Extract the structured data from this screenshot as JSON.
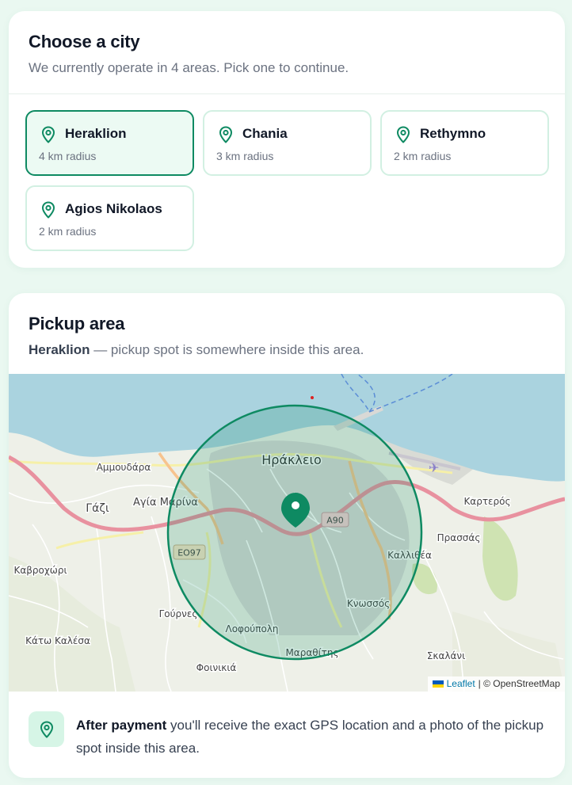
{
  "city_card": {
    "title": "Choose a city",
    "subtitle": "We currently operate in 4 areas. Pick one to continue."
  },
  "cities": [
    {
      "name": "Heraklion",
      "radius": "4 km radius",
      "selected": true
    },
    {
      "name": "Chania",
      "radius": "3 km radius",
      "selected": false
    },
    {
      "name": "Rethymno",
      "radius": "2 km radius",
      "selected": false
    },
    {
      "name": "Agios Nikolaos",
      "radius": "2 km radius",
      "selected": false
    }
  ],
  "pickup_card": {
    "title": "Pickup area",
    "city": "Heraklion",
    "subtitle_rest": " — pickup spot is somewhere inside this area."
  },
  "map": {
    "labels": {
      "heraklion": "Ηράκλειο",
      "ammoudara": "Αμμουδάρα",
      "gazi": "Γάζι",
      "agia_marina": "Αγία Μαρίνα",
      "kavrochori": "Καβροχώρι",
      "gournes": "Γούρνες",
      "kato_kalesa": "Κάτω Καλέσα",
      "lofoupoli": "Λοφούπολη",
      "foinikia": "Φοινικιά",
      "marathitis": "Μαραθίτης",
      "knossos": "Κνωσσός",
      "kallithea": "Καλλιθέα",
      "prassas": "Πρασσάς",
      "karteros": "Καρτερός",
      "skalani": "Σκαλάνι",
      "road_a90": "A90",
      "road_eo97": "ΕΟ97"
    },
    "attribution": {
      "leaflet": "Leaflet",
      "separator": " | © OpenStreetMap"
    },
    "colors": {
      "circle": "#0e8a62",
      "sea": "#aad3df",
      "motorway": "#e8919f"
    }
  },
  "note": {
    "bold": "After payment",
    "text": " you'll receive the exact GPS location and a photo of the pickup spot inside this area."
  }
}
